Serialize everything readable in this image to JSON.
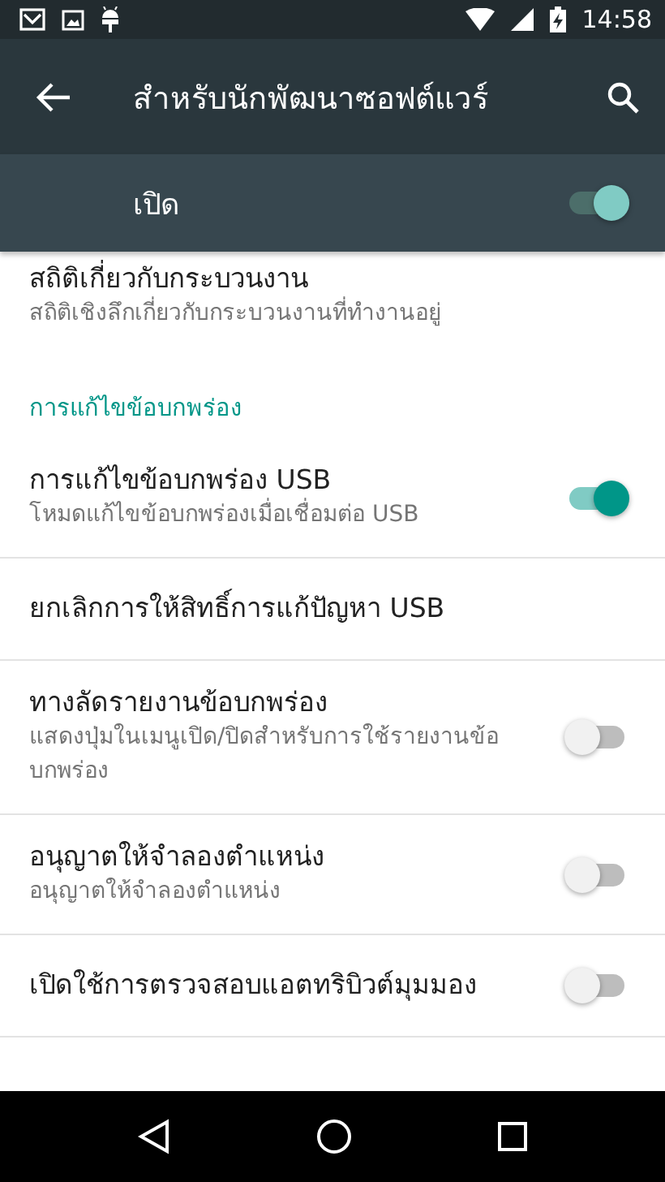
{
  "status_bar": {
    "time": "14:58"
  },
  "toolbar": {
    "title": "สำหรับนักพัฒนาซอฟต์แวร์"
  },
  "master": {
    "label": "เปิด",
    "on": true
  },
  "items": [
    {
      "kind": "text",
      "title": "สถิติเกี่ยวกับกระบวนงาน",
      "subtitle": "สถิติเชิงลึกเกี่ยวกับกระบวนงานที่ทำงานอยู่"
    },
    {
      "kind": "header",
      "title": "การแก้ไขข้อบกพร่อง"
    },
    {
      "kind": "switch",
      "title": "การแก้ไขข้อบกพร่อง USB",
      "subtitle": "โหมดแก้ไขข้อบกพร่องเมื่อเชื่อมต่อ USB",
      "on": true
    },
    {
      "kind": "text",
      "title": "ยกเลิกการให้สิทธิ์การแก้ปัญหา USB"
    },
    {
      "kind": "switch",
      "title": "ทางลัดรายงานข้อบกพร่อง",
      "subtitle": "แสดงปุ่มในเมนูเปิด/ปิดสำหรับการใช้รายงานข้อบกพร่อง",
      "on": false
    },
    {
      "kind": "switch",
      "title": "อนุญาตให้จำลองตำแหน่ง",
      "subtitle": "อนุญาตให้จำลองตำแหน่ง",
      "on": false
    },
    {
      "kind": "switch",
      "title": "เปิดใช้การตรวจสอบแอตทริบิวต์มุมมอง",
      "on": false
    }
  ]
}
